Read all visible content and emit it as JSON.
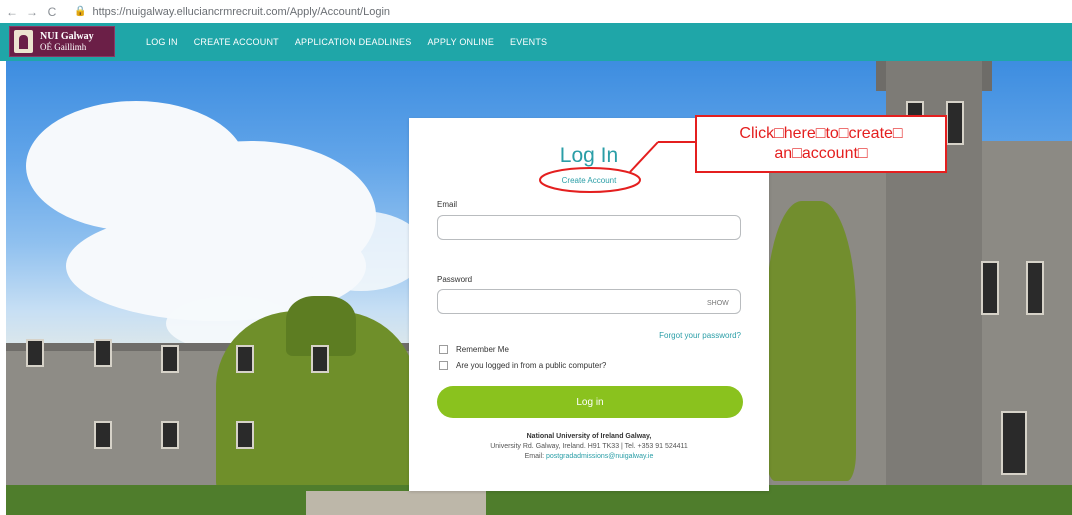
{
  "browser": {
    "back_icon": "←",
    "forward_icon": "→",
    "reload_icon": "C",
    "lock_icon": "🔒",
    "url": "https://nuigalway.elluciancrmrecruit.com/Apply/Account/Login"
  },
  "nav": {
    "logo_line1": "NUI Galway",
    "logo_line2": "OÉ Gaillimh",
    "links": [
      "LOG IN",
      "CREATE ACCOUNT",
      "APPLICATION DEADLINES",
      "APPLY ONLINE",
      "EVENTS"
    ]
  },
  "login": {
    "title": "Log In",
    "create_account": "Create Account",
    "email_label": "Email",
    "email_value": "",
    "password_label": "Password",
    "password_value": "",
    "show_label": "SHOW",
    "forgot": "Forgot your password?",
    "remember": "Remember Me",
    "public_computer": "Are you logged in from a public computer?",
    "button": "Log in",
    "footer_org": "National University of Ireland Galway,",
    "footer_address": "University Rd. Galway, Ireland. H91 TK33 | Tel. +353 91 524411",
    "footer_email_label": "Email: ",
    "footer_email": "postgradadmissions@nuigalway.ie"
  },
  "annotation": {
    "line1": "Click□here□to□create□",
    "line2": "an□account□",
    "color": "#e41f1f"
  },
  "colors": {
    "nav_bg": "#1fa6a8",
    "logo_bg": "#6b1f47",
    "accent": "#2a9ea7",
    "button": "#8ac21e"
  }
}
